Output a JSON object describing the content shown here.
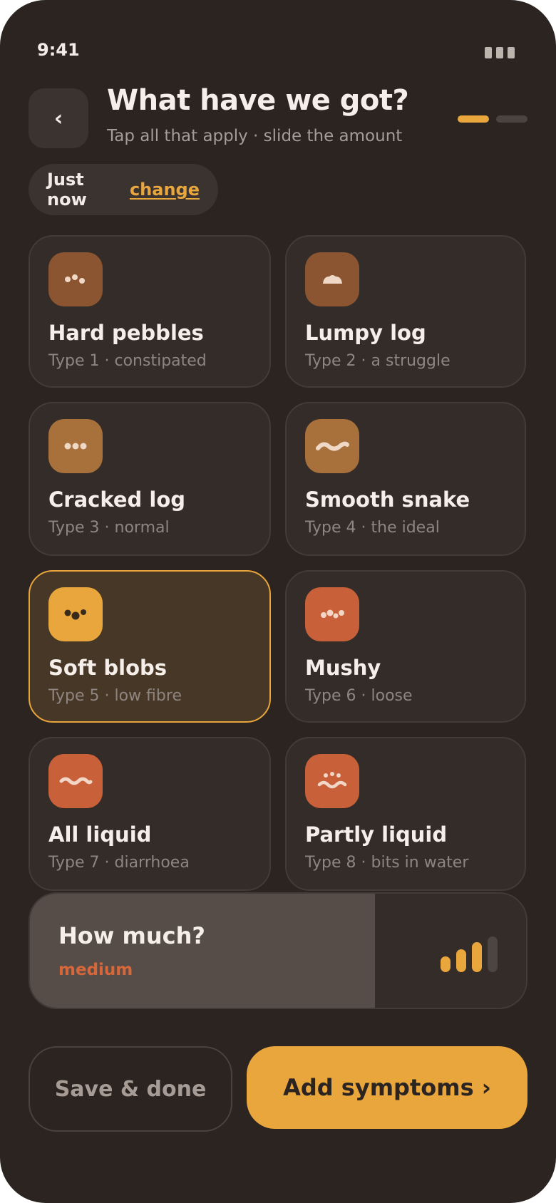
{
  "status": {
    "time": "9:41"
  },
  "header": {
    "back_glyph": "‹",
    "title": "What have we got?",
    "subtitle": "Tap all that apply · slide the amount",
    "step_current": 1,
    "step_total": 2
  },
  "time_pill": {
    "label": "Just now",
    "action": "change"
  },
  "types": [
    {
      "name": "Hard pebbles",
      "desc": "Type 1 · constipated",
      "icon": "pebbles-icon",
      "color": "#8a5530",
      "selected": false
    },
    {
      "name": "Lumpy log",
      "desc": "Type 2 · a struggle",
      "icon": "lump-icon",
      "color": "#8a5530",
      "selected": false
    },
    {
      "name": "Cracked log",
      "desc": "Type 3 · normal",
      "icon": "cracked-icon",
      "color": "#a8703a",
      "selected": false
    },
    {
      "name": "Smooth snake",
      "desc": "Type 4 · the ideal",
      "icon": "snake-icon",
      "color": "#a8703a",
      "selected": false
    },
    {
      "name": "Soft blobs",
      "desc": "Type 5 · low fibre",
      "icon": "blobs-icon",
      "color": "#e9a63c",
      "selected": true
    },
    {
      "name": "Mushy",
      "desc": "Type 6 · loose",
      "icon": "mushy-icon",
      "color": "#c8603a",
      "selected": false
    },
    {
      "name": "All liquid",
      "desc": "Type 7 · diarrhoea",
      "icon": "liquid-icon",
      "color": "#c8603a",
      "selected": false
    },
    {
      "name": "Partly liquid",
      "desc": "Type 8 · bits in water",
      "icon": "bits-in-water-icon",
      "color": "#c8603a",
      "selected": false
    }
  ],
  "amount": {
    "label": "How much?",
    "value": "medium",
    "level": 3,
    "levels": 4,
    "fill_fraction": 0.695
  },
  "actions": {
    "secondary": "Save & done",
    "primary": "Add symptoms ›"
  },
  "colors": {
    "accent": "#e9a63c",
    "background": "#2b2421",
    "card": "#332c29",
    "warning": "#d5673b"
  }
}
